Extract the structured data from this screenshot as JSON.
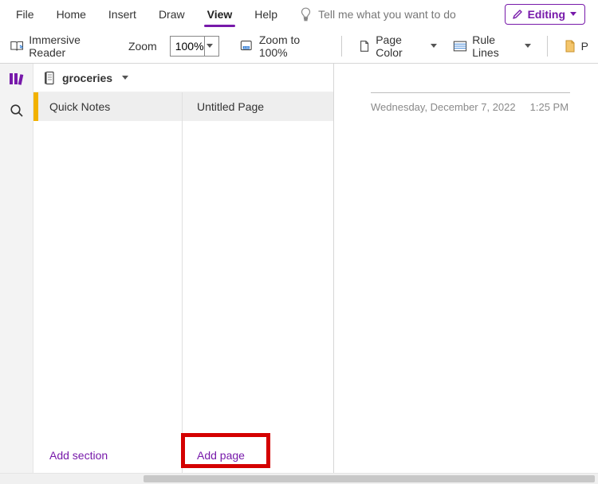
{
  "tabs": {
    "file": "File",
    "home": "Home",
    "insert": "Insert",
    "draw": "Draw",
    "view": "View",
    "help": "Help"
  },
  "tell_me": "Tell me what you want to do",
  "editing_button": "Editing",
  "ribbon": {
    "immersive_reader": "Immersive Reader",
    "zoom_label": "Zoom",
    "zoom_value": "100%",
    "zoom_to_100": "Zoom to 100%",
    "page_color": "Page Color",
    "rule_lines": "Rule Lines",
    "paper_partial": "P"
  },
  "notebook": {
    "name": "groceries"
  },
  "section": {
    "selected": "Quick Notes"
  },
  "page": {
    "selected": "Untitled Page"
  },
  "footer": {
    "add_section": "Add section",
    "add_page": "Add page"
  },
  "canvas": {
    "date": "Wednesday, December 7, 2022",
    "time": "1:25 PM"
  }
}
